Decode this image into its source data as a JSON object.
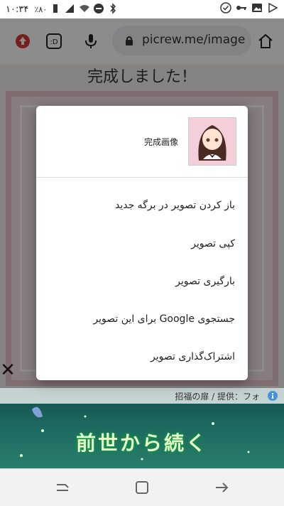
{
  "status_bar": {
    "time": "۱۰:۳۴",
    "battery": "٪۸۰"
  },
  "browser": {
    "url": "picrew.me/image"
  },
  "page": {
    "title": "完成しました！"
  },
  "context_menu": {
    "image_label": "完成画像",
    "items": [
      "باز کردن تصویر در برگه جدید",
      "کپی تصویر",
      "بارگیری تصویر",
      "جستجوی Google برای این تصویر",
      "اشتراک‌گذاری تصویر"
    ]
  },
  "ad": {
    "caption": "招福の扉 / 提供：フォ",
    "headline": "前世から続く"
  }
}
